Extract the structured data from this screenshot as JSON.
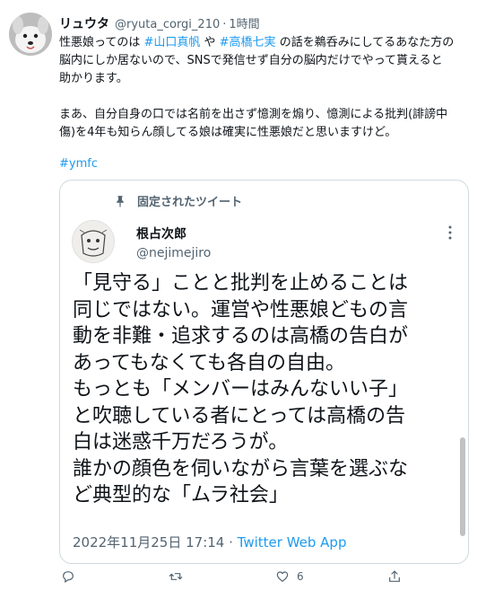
{
  "tweet": {
    "author_name": "リュウタ",
    "handle": "@ryuta_corgi_210",
    "separator": "·",
    "time": "1時間",
    "body": {
      "l1_pre": "性悪娘ってのは ",
      "l1_tag1": "#山口真帆",
      "l1_mid": " や ",
      "l1_tag2": "#高橋七実",
      "l1_post": " の話を鵜呑みにしてるあなた方の",
      "l2": "脳内にしか居ないので、SNSで発信せず自分の脳内だけでやって貰えると",
      "l3": "助かります。",
      "l4": "まあ、自分自身の口では名前を出さず憶測を煽り、憶測による批判(誹謗中",
      "l5": "傷)を4年も知らん顔してる娘は確実に性悪娘だと思いますけど。"
    },
    "hashtag": "#ymfc"
  },
  "quote": {
    "pinned_label": "固定されたツイート",
    "author_name": "根占次郎",
    "handle": "@nejimejiro",
    "lines": [
      "「見守る」ことと批判を止めることは",
      "同じではない。運営や性悪娘どもの言",
      "動を非難・追求するのは高橋の告白が",
      "あってもなくても各自の自由。",
      "もっとも「メンバーはみんないい子」",
      "と吹聴している者にとっては高橋の告",
      "白は迷惑千万だろうが。",
      "誰かの顔色を伺いながら言葉を選ぶな",
      "ど典型的な「ムラ社会」"
    ],
    "timestamp": "2022年11月25日 17:14",
    "meta_sep": " · ",
    "source": "Twitter Web App"
  },
  "actions": {
    "reply_icon": "reply-icon",
    "retweet_icon": "retweet-icon",
    "like_icon": "like-icon",
    "like_count": "6",
    "share_icon": "share-icon"
  },
  "colors": {
    "link": "#1d9bf0",
    "secondary_text": "#536471",
    "border": "#cfd9de"
  }
}
